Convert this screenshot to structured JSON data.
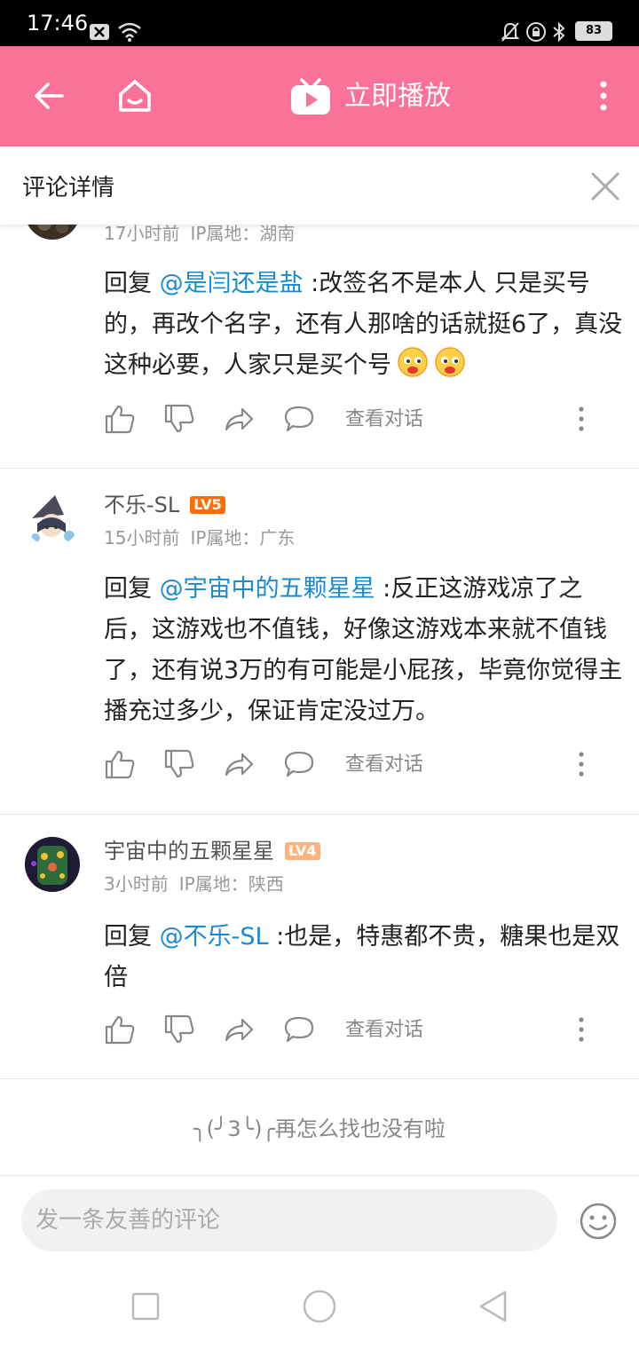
{
  "status_bar": {
    "time": "17:46",
    "battery": "83"
  },
  "top_bar": {
    "title": "立即播放"
  },
  "detail": {
    "title": "评论详情"
  },
  "comments": [
    {
      "meta_time": "17小时前",
      "meta_ip": "IP属地：湖南",
      "reply_prefix": "回复 ",
      "mention": "@是闫还是盐",
      "text": " :改签名不是本人 只是买号的，再改个名字，还有人那啥的话就挺6了，真没这种必要，人家只是买个号",
      "action_text": "查看对话"
    },
    {
      "username": "不乐-SL",
      "level": "LV5",
      "level_color": "#ff6c00",
      "meta_time": "15小时前",
      "meta_ip": "IP属地：广东",
      "reply_prefix": "回复 ",
      "mention": "@宇宙中的五颗星星",
      "text": " :反正这游戏凉了之后，这游戏也不值钱，好像这游戏本来就不值钱了，还有说3万的有可能是小屁孩，毕竟你觉得主播充过多少，保证肯定没过万。",
      "action_text": "查看对话"
    },
    {
      "username": "宇宙中的五颗星星",
      "level": "LV4",
      "level_color": "#ffb37c",
      "meta_time": "3小时前",
      "meta_ip": "IP属地：陕西",
      "reply_prefix": "回复 ",
      "mention": "@不乐-SL",
      "text": " :也是，特惠都不贵，糖果也是双倍",
      "action_text": "查看对话"
    }
  ],
  "end_tip": "╮(╯3╰)╭再怎么找也没有啦",
  "comment_input": {
    "placeholder": "发一条友善的评论"
  },
  "colors": {
    "brand_pink": "#fb7299",
    "mention_blue": "#178bcf"
  }
}
